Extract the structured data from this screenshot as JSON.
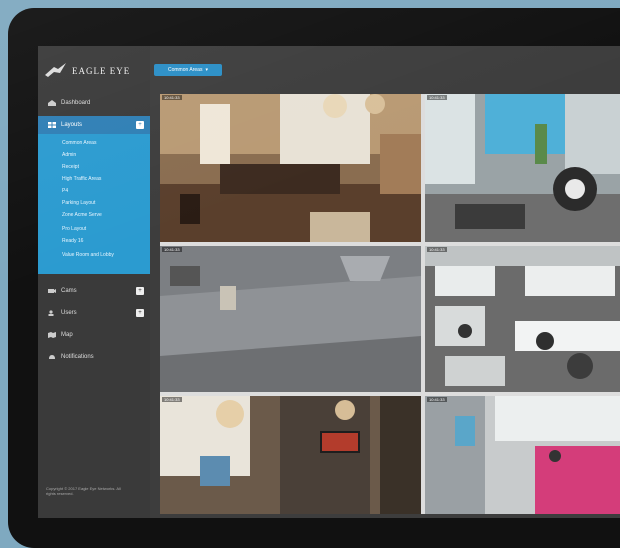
{
  "app": {
    "brand": "EAGLE EYE",
    "layout_button_label": "Common Areas",
    "copyright": "Copyright © 2017 Eagle Eye Networks. All rights reserved."
  },
  "sidebar": {
    "items": [
      {
        "label": "Dashboard",
        "icon": "home-icon",
        "badge": ""
      },
      {
        "label": "Layouts",
        "icon": "grid-icon",
        "badge": "+"
      },
      {
        "label": "Cams",
        "icon": "camera-icon",
        "badge": "+"
      },
      {
        "label": "Users",
        "icon": "users-icon",
        "badge": "+"
      },
      {
        "label": "Map",
        "icon": "map-icon",
        "badge": ""
      },
      {
        "label": "Notifications",
        "icon": "bell-icon",
        "badge": ""
      }
    ],
    "layouts": [
      "Common Areas",
      "Admin",
      "Receipt",
      "High Traffic Areas",
      "P4",
      "Parking Layout",
      "Zone Acme Serve",
      "Pro Layout",
      "Ready 16",
      "Value Room and Lobby"
    ]
  },
  "tiles": [
    {
      "timestamp": "10:41:33"
    },
    {
      "timestamp": "10:41:33"
    },
    {
      "timestamp": "10:41:33"
    },
    {
      "timestamp": "10:41:33"
    },
    {
      "timestamp": "10:41:33"
    },
    {
      "timestamp": "10:41:33"
    }
  ],
  "colors": {
    "sidebar_bg": "#3a3a3a",
    "active": "#2f7fb5",
    "submenu": "#2b9bd0",
    "screen_bg": "#3d3d3d"
  }
}
